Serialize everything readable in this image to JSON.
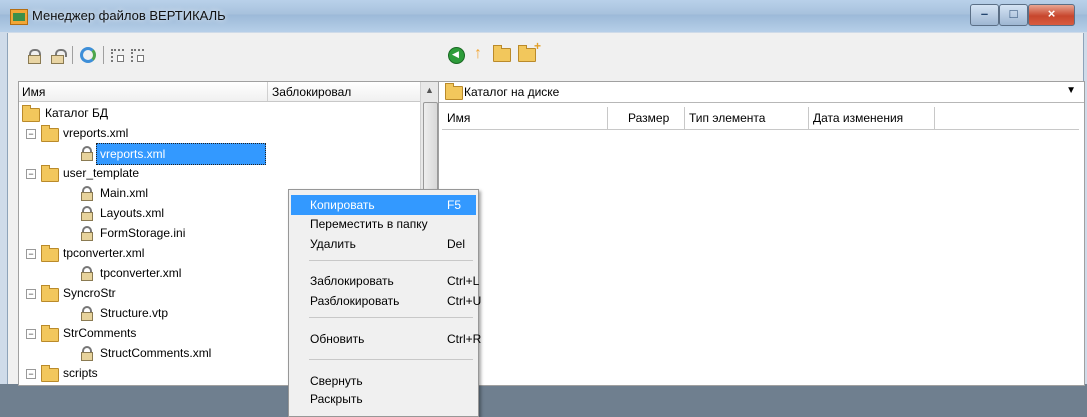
{
  "window": {
    "title": "Менеджер файлов ВЕРТИКАЛЬ",
    "controls": {
      "minimize": "–",
      "maximize": "□",
      "close": "×"
    }
  },
  "toolbar": {
    "left_icons": [
      "lock-icon",
      "unlock-icon",
      "refresh-icon",
      "tree-icon",
      "tree-collapse-icon"
    ],
    "right_icons": [
      "back-icon",
      "up-folder-icon",
      "open-folder-icon",
      "new-folder-icon"
    ]
  },
  "left_panel": {
    "headers": [
      "Имя",
      "Заблокировал"
    ],
    "scroll_arrow": "▲",
    "tree": [
      {
        "label": "Каталог БД",
        "type": "folder"
      },
      {
        "label": "vreports.xml",
        "type": "folder"
      },
      {
        "label": "vreports.xml",
        "type": "file",
        "selected": true
      },
      {
        "label": "user_template",
        "type": "folder"
      },
      {
        "label": "Main.xml",
        "type": "file"
      },
      {
        "label": "Layouts.xml",
        "type": "file"
      },
      {
        "label": "FormStorage.ini",
        "type": "file"
      },
      {
        "label": "tpconverter.xml",
        "type": "folder"
      },
      {
        "label": "tpconverter.xml",
        "type": "file"
      },
      {
        "label": "SyncroStr",
        "type": "folder"
      },
      {
        "label": "Structure.vtp",
        "type": "file"
      },
      {
        "label": "StrComments",
        "type": "folder"
      },
      {
        "label": "StructComments.xml",
        "type": "file"
      },
      {
        "label": "scripts",
        "type": "folder"
      }
    ]
  },
  "right_panel": {
    "path": "Каталог на диске",
    "dropdown_arrow": "▼",
    "headers": [
      "Имя",
      "Размер",
      "Тип элемента",
      "Дата изменения"
    ]
  },
  "context_menu": {
    "items": [
      {
        "label": "Копировать",
        "shortcut": "F5",
        "highlighted": true
      },
      {
        "label": "Переместить в папку",
        "shortcut": ""
      },
      {
        "label": "Удалить",
        "shortcut": "Del"
      },
      {
        "label": "Заблокировать",
        "shortcut": "Ctrl+L"
      },
      {
        "label": "Разблокировать",
        "shortcut": "Ctrl+U"
      },
      {
        "label": "Обновить",
        "shortcut": "Ctrl+R"
      },
      {
        "label": "Свернуть",
        "shortcut": ""
      },
      {
        "label": "Раскрыть",
        "shortcut": ""
      }
    ]
  },
  "colors": {
    "selection": "#3399ff",
    "titlebar": "#a7c1dc",
    "close": "#c7462d"
  }
}
